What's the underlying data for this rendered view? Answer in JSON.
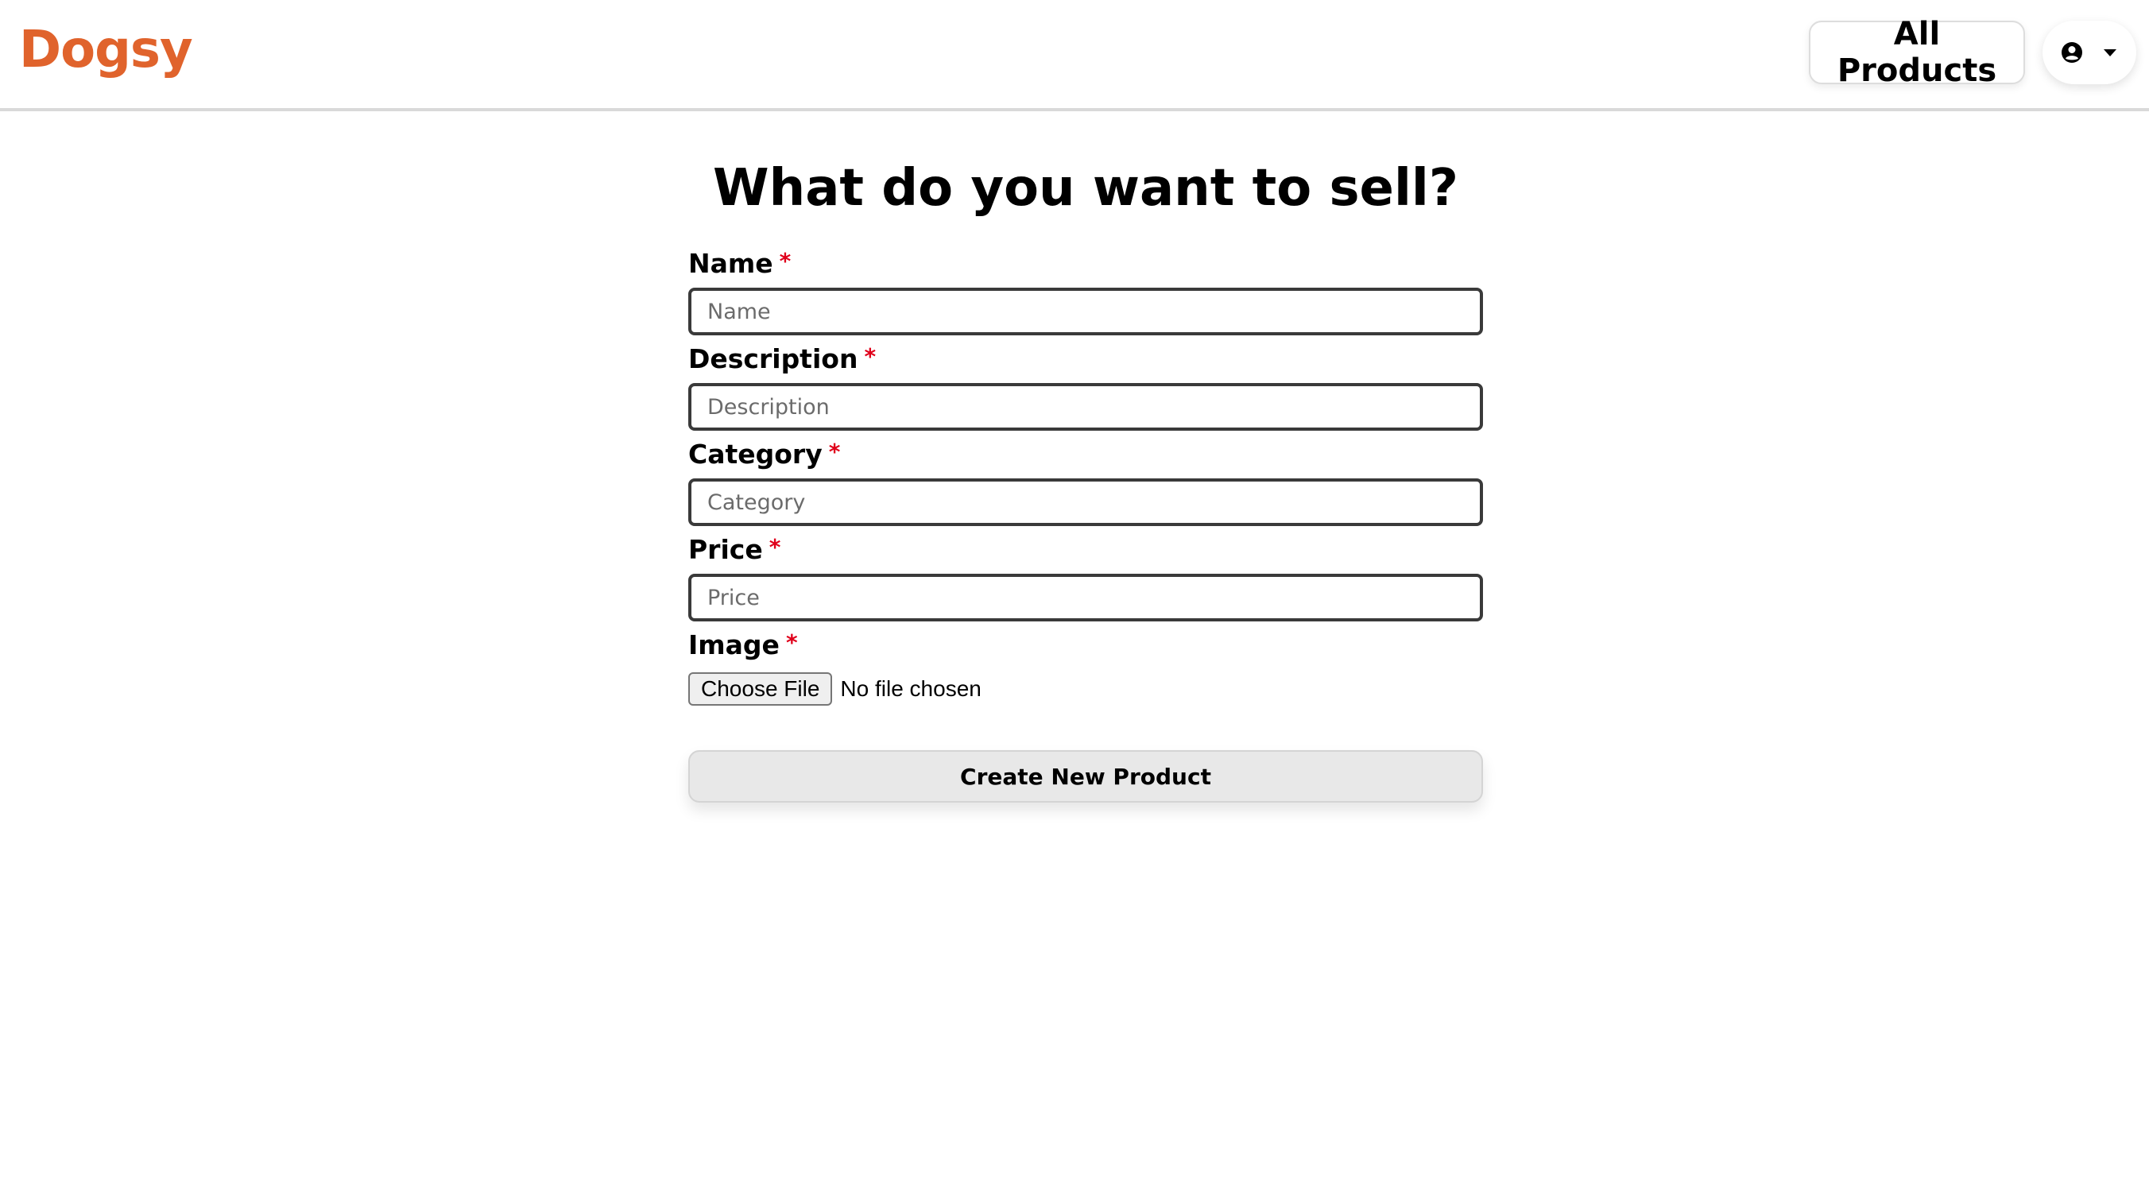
{
  "header": {
    "logo": "Dogsy",
    "all_products_label": "All Products",
    "user_menu_icon": "user-circle-icon",
    "dropdown_icon": "caret-down-icon"
  },
  "form": {
    "title": "What do you want to sell?",
    "required_mark": "*",
    "fields": {
      "name": {
        "label": "Name",
        "placeholder": "Name",
        "value": ""
      },
      "description": {
        "label": "Description",
        "placeholder": "Description",
        "value": ""
      },
      "category": {
        "label": "Category",
        "placeholder": "Category",
        "value": ""
      },
      "price": {
        "label": "Price",
        "placeholder": "Price",
        "value": ""
      }
    },
    "image": {
      "label": "Image",
      "button_label": "Choose File",
      "status": "No file chosen"
    },
    "submit_label": "Create New Product"
  },
  "colors": {
    "brand": "#e0632c",
    "required": "#e0001b",
    "input_border": "#3a3a3a",
    "submit_bg": "#e8e8e8"
  }
}
